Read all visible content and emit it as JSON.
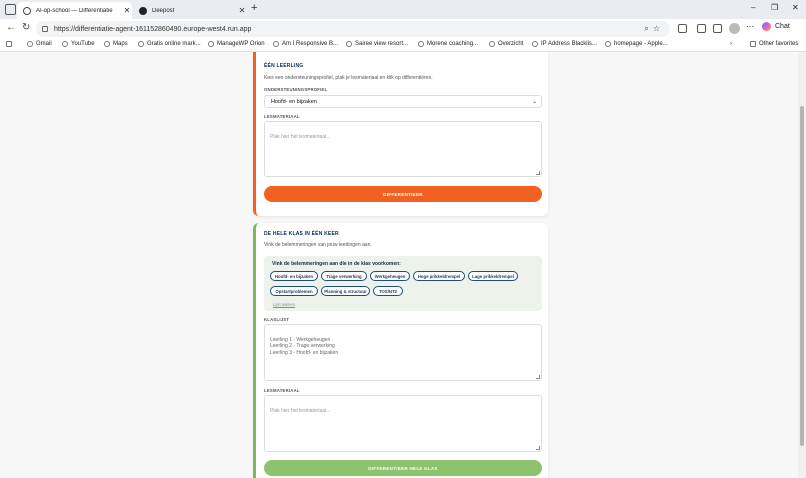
{
  "browser": {
    "tabs": [
      {
        "label": "AI-op-school — Differentiatie",
        "close": "✕"
      },
      {
        "label": "Deepost",
        "close": "✕"
      }
    ],
    "new_tab": "+",
    "window_controls": {
      "minimize": "–",
      "restore": "❐",
      "close": "✕"
    },
    "url": "https://differentiatie-agent-161152860490.europe-west4.run.app",
    "chat_label": "Chat",
    "bookmarks": [
      "Gmail",
      "YouTube",
      "Maps",
      "Gratis online mark...",
      "ManageWP Orion",
      "Am I Responsive B...",
      "Sairee view resort...",
      "Morene coaching...",
      "Overzicht",
      "IP Address Blacklis...",
      "homepage - Apple..."
    ],
    "other_favorites": "Other favorites"
  },
  "single_student": {
    "title": "ÉÉN LEERLING",
    "description": "Kies een ondersteuningsprofiel, plak je lesmateriaal en klik op differentiëren.",
    "profile_label": "ONDERSTEUNINGSPROFIEL",
    "profile_value": "Hoofd- en bijzaken",
    "material_label": "LESMATERIAAL",
    "material_placeholder": "Plak hier het lesmateriaal...",
    "button": "DIFFERENTIEER"
  },
  "whole_class": {
    "title": "DE HELE KLAS IN ÉÉN KEER",
    "description": "Vink de belemmeringen van jouw leerlingen aan.",
    "chip_box_title": "Vink de belemmeringen aan die in de klas voorkomen:",
    "chips": [
      "Hoofd- en bijzaken",
      "Trage verwerking",
      "Werkgeheugen",
      "Hoge prikkeldrempel",
      "Lage prikkeldrempel",
      "Opstartproblemen",
      "Planning & structuur",
      "TOS/NT2"
    ],
    "clear_link": "Lijst wissen",
    "class_list_label": "KLASLIJST",
    "class_list_value": "Leerling 1 - Werkgeheugen\nLeerling 2 - Trage verwerking\nLeerling 3 - Hoofd- en bijzaken",
    "material_label": "LESMATERIAAL",
    "material_placeholder": "Plak hier het lesmateriaal...",
    "button": "DIFFERENTIEER HELE KLAS"
  },
  "colors": {
    "accent_orange": "#f26122",
    "accent_green": "#78b95a",
    "navy": "#0c2b52"
  }
}
